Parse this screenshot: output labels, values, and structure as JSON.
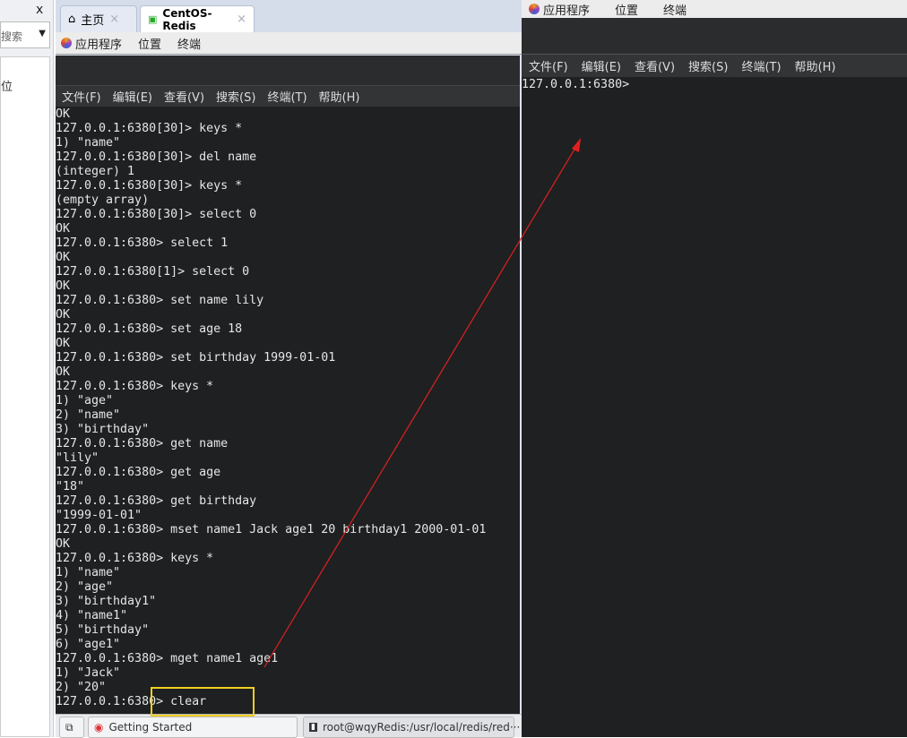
{
  "left_panel": {
    "close": "x",
    "search_placeholder": "搜索",
    "item": "位"
  },
  "tabs": [
    {
      "label": "主页",
      "close": "×"
    },
    {
      "label": "CentOS-Redis",
      "close": "×"
    }
  ],
  "gnome_menu": [
    "应用程序",
    "位置",
    "终端"
  ],
  "terminal_menu": [
    "文件(F)",
    "编辑(E)",
    "查看(V)",
    "搜索(S)",
    "终端(T)",
    "帮助(H)"
  ],
  "terminal_lines": [
    "OK",
    "127.0.0.1:6380[30]> keys *",
    "1) \"name\"",
    "127.0.0.1:6380[30]> del name",
    "(integer) 1",
    "127.0.0.1:6380[30]> keys *",
    "(empty array)",
    "127.0.0.1:6380[30]> select 0",
    "OK",
    "127.0.0.1:6380> select 1",
    "OK",
    "127.0.0.1:6380[1]> select 0",
    "OK",
    "127.0.0.1:6380> set name lily",
    "OK",
    "127.0.0.1:6380> set age 18",
    "OK",
    "127.0.0.1:6380> set birthday 1999-01-01",
    "OK",
    "127.0.0.1:6380> keys *",
    "1) \"age\"",
    "2) \"name\"",
    "3) \"birthday\"",
    "127.0.0.1:6380> get name",
    "\"lily\"",
    "127.0.0.1:6380> get age",
    "\"18\"",
    "127.0.0.1:6380> get birthday",
    "\"1999-01-01\"",
    "127.0.0.1:6380> mset name1 Jack age1 20 birthday1 2000-01-01",
    "OK",
    "127.0.0.1:6380> keys *",
    "1) \"name\"",
    "2) \"age\"",
    "3) \"birthday1\"",
    "4) \"name1\"",
    "5) \"birthday\"",
    "6) \"age1\"",
    "127.0.0.1:6380> mget name1 age1",
    "1) \"Jack\"",
    "2) \"20\"",
    "127.0.0.1:6380> clear"
  ],
  "taskbar": {
    "getting_started": "Getting Started",
    "terminal_task": "root@wqyRedis:/usr/local/redis/red···"
  },
  "right_terminal": {
    "prompt": "127.0.0.1:6380>"
  },
  "colors": {
    "annotation_box": "#f0d020",
    "arrow": "#e02020"
  }
}
